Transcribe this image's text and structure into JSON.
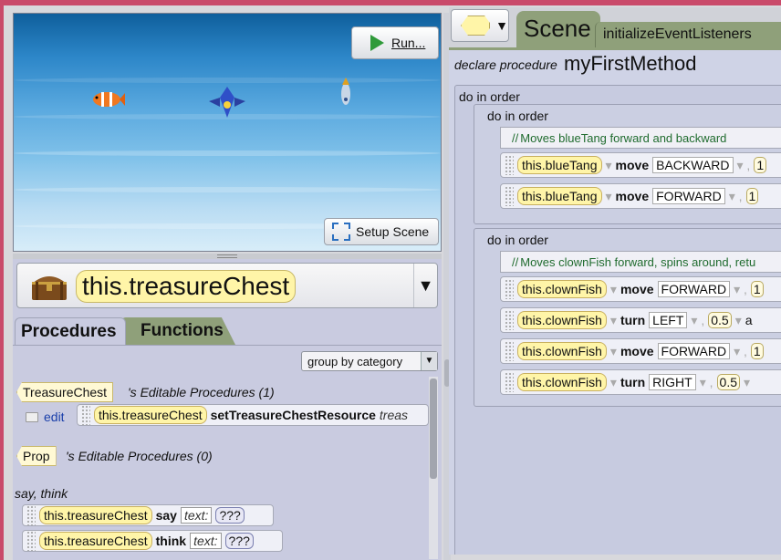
{
  "scene_view": {
    "run_label": "Run...",
    "setup_label": "Setup Scene"
  },
  "selector": {
    "value": "this.treasureChest"
  },
  "tabs": {
    "procedures": "Procedures",
    "functions": "Functions"
  },
  "procedures_panel": {
    "group_by": "group by category",
    "sections": [
      {
        "type": "TreasureChest",
        "title": "'s Editable Procedures (1)"
      },
      {
        "type": "Prop",
        "title": "'s Editable Procedures (0)"
      }
    ],
    "edit_label": "edit",
    "set_resource": {
      "obj": "this.treasureChest",
      "method": "setTreasureChestResource",
      "arg": "treas"
    },
    "category": "say, think",
    "say": {
      "obj": "this.treasureChest",
      "method": "say",
      "arg": "text:",
      "value": "???"
    },
    "think": {
      "obj": "this.treasureChest",
      "method": "think",
      "arg": "text:",
      "value": "???"
    }
  },
  "code_tabs": {
    "scene": "Scene",
    "init": "initializeEventListeners"
  },
  "method": {
    "declare": "declare procedure",
    "name": "myFirstMethod",
    "do_in_order": "do in order",
    "block1": {
      "comment": "Moves blueTang forward and backward",
      "stmts": [
        {
          "obj": "this.blueTang",
          "action": "move",
          "dir": "BACKWARD",
          "amt": "1"
        },
        {
          "obj": "this.blueTang",
          "action": "move",
          "dir": "FORWARD",
          "amt": "1"
        }
      ]
    },
    "block2": {
      "comment": "Moves clownFish forward, spins around, retu",
      "stmts": [
        {
          "obj": "this.clownFish",
          "action": "move",
          "dir": "FORWARD",
          "amt": "1"
        },
        {
          "obj": "this.clownFish",
          "action": "turn",
          "dir": "LEFT",
          "amt": "0.5",
          "extra": "a"
        },
        {
          "obj": "this.clownFish",
          "action": "move",
          "dir": "FORWARD",
          "amt": "1"
        },
        {
          "obj": "this.clownFish",
          "action": "turn",
          "dir": "RIGHT",
          "amt": "0.5"
        }
      ]
    }
  }
}
